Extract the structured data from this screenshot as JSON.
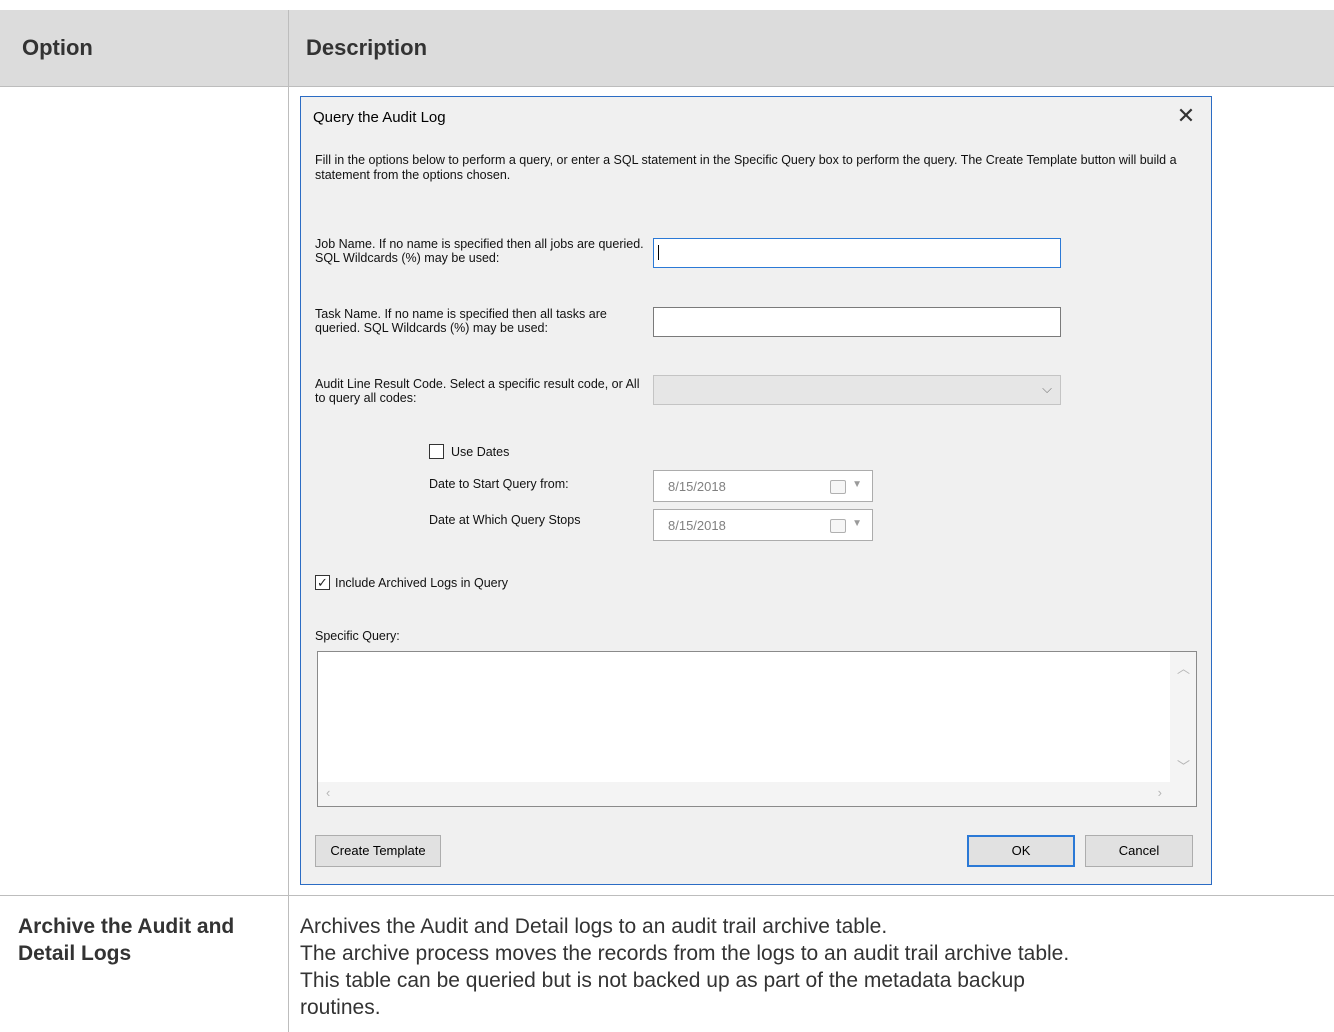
{
  "table": {
    "header": {
      "option": "Option",
      "description": "Description"
    },
    "row2": {
      "option": "Archive the Audit and Detail Logs",
      "description_lines": [
        "Archives the Audit and Detail logs to an audit trail archive table.",
        "The archive process moves the records from the logs to an audit trail archive table.",
        "This table can be queried but is not backed up as part of the metadata backup",
        "routines."
      ]
    }
  },
  "dialog": {
    "title": "Query the Audit Log",
    "close_glyph": "✕",
    "intro": "Fill in the options below to perform a query, or enter a SQL statement in the Specific Query box to perform the query. The Create Template button will build a statement from the options chosen.",
    "job_name_label": "Job Name. If no name is specified then all jobs are queried. SQL Wildcards (%) may be used:",
    "job_name_value": "",
    "task_name_label": "Task Name. If no name is specified then all tasks are queried. SQL Wildcards (%) may be used:",
    "task_name_value": "",
    "result_code_label": "Audit Line Result Code.  Select a specific result code, or All to query all codes:",
    "result_code_value": "",
    "use_dates_label": "Use Dates",
    "use_dates_checked": false,
    "start_date_label": "Date to Start Query from:",
    "start_date_value": "8/15/2018",
    "stop_date_label": "Date at Which Query Stops",
    "stop_date_value": "8/15/2018",
    "include_archived_label": "Include Archived Logs in Query",
    "include_archived_checked": true,
    "specific_query_label": "Specific Query:",
    "specific_query_value": "",
    "create_template_label": "Create Template",
    "ok_label": "OK",
    "cancel_label": "Cancel"
  },
  "icons": {
    "close": "close-icon",
    "chevron": "chevron-down-icon",
    "calendar": "calendar-icon",
    "check": "checkmark-icon"
  }
}
